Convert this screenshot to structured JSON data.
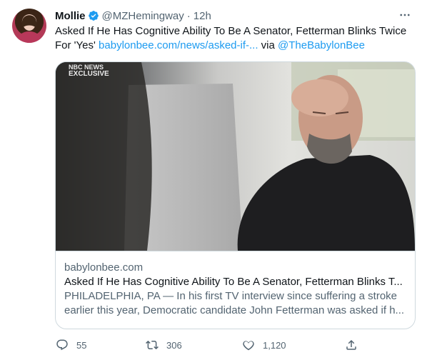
{
  "author": {
    "name": "Mollie",
    "handle": "@MZHemingway",
    "separator": "·",
    "time": "12h"
  },
  "tweet": {
    "text_main": "Asked If He Has Cognitive Ability To Be A Senator, Fetterman Blinks Twice For 'Yes' ",
    "link_text": "babylonbee.com/news/asked-if-...",
    "via_text": " via ",
    "mention": "@TheBabylonBee"
  },
  "card": {
    "image_watermark_line1": "NBC NEWS",
    "image_watermark_line2": "EXCLUSIVE",
    "domain": "babylonbee.com",
    "title": "Asked If He Has Cognitive Ability To Be A Senator, Fetterman Blinks T...",
    "description": "PHILADELPHIA, PA — In his first TV interview since suffering a stroke earlier this year, Democratic candidate John Fetterman was asked if h..."
  },
  "actions": {
    "reply_count": "55",
    "retweet_count": "306",
    "like_count": "1,120"
  },
  "icons": {
    "verified": "verified-badge-icon",
    "more": "more-icon",
    "reply": "reply-icon",
    "retweet": "retweet-icon",
    "like": "like-icon",
    "share": "share-icon"
  },
  "colors": {
    "accent": "#1d9bf0",
    "text": "#0f1419",
    "secondary": "#536471",
    "border": "#cfd9de"
  }
}
